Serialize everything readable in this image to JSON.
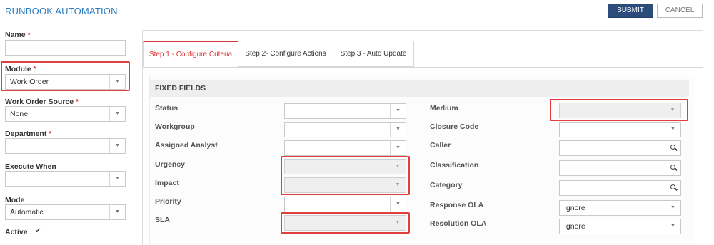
{
  "header": {
    "title": "RUNBOOK AUTOMATION",
    "submit_label": "SUBMIT",
    "cancel_label": "CANCEL"
  },
  "left_form": {
    "name": {
      "label": "Name",
      "required": "*",
      "value": ""
    },
    "module": {
      "label": "Module",
      "required": "*",
      "value": "Work Order"
    },
    "work_order_source": {
      "label": "Work Order Source",
      "required": "*",
      "value": "None"
    },
    "department": {
      "label": "Department",
      "required": "*",
      "value": ""
    },
    "execute_when": {
      "label": "Execute When",
      "value": ""
    },
    "mode": {
      "label": "Mode",
      "value": "Automatic"
    },
    "active": {
      "label": "Active",
      "checked": true,
      "check_glyph": "✔"
    }
  },
  "tabs": [
    {
      "label": "Step 1 - Configure Criteria",
      "active": true
    },
    {
      "label": "Step 2- Configure Actions",
      "active": false
    },
    {
      "label": "Step 3 - Auto Update",
      "active": false
    }
  ],
  "fixed_fields": {
    "heading": "FIXED FIELDS",
    "left_column": [
      {
        "label": "Status",
        "value": "",
        "disabled": false
      },
      {
        "label": "Workgroup",
        "value": "",
        "disabled": false
      },
      {
        "label": "Assigned Analyst",
        "value": "",
        "disabled": false
      },
      {
        "label": "Urgency",
        "value": "",
        "disabled": true
      },
      {
        "label": "Impact",
        "value": "",
        "disabled": true
      },
      {
        "label": "Priority",
        "value": "",
        "disabled": false
      },
      {
        "label": "SLA",
        "value": "",
        "disabled": true
      }
    ],
    "right_column": [
      {
        "label": "Medium",
        "type": "select",
        "value": "",
        "disabled": true
      },
      {
        "label": "Closure Code",
        "type": "select",
        "value": "",
        "disabled": false
      },
      {
        "label": "Caller",
        "type": "lookup",
        "value": ""
      },
      {
        "label": "Classification",
        "type": "lookup",
        "value": ""
      },
      {
        "label": "Category",
        "type": "lookup",
        "value": ""
      },
      {
        "label": "Response OLA",
        "type": "select",
        "value": "Ignore",
        "disabled": false
      },
      {
        "label": "Resolution OLA",
        "type": "select",
        "value": "Ignore",
        "disabled": false
      }
    ]
  },
  "icons": {
    "dropdown": "chevron-down-icon",
    "lookup": "search-icon",
    "check": "checkmark-icon"
  },
  "colors": {
    "accent_blue": "#2f7bbf",
    "submit_bg": "#2c4d7c",
    "required_red": "#d9383a",
    "highlight_red": "#e03f3f"
  }
}
